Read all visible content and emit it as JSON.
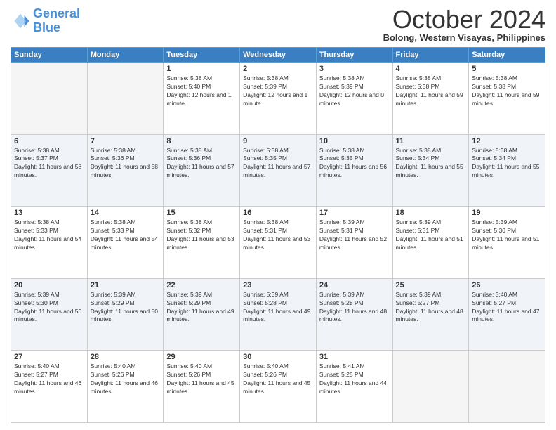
{
  "logo": {
    "line1": "General",
    "line2": "Blue"
  },
  "title": "October 2024",
  "location": "Bolong, Western Visayas, Philippines",
  "days_of_week": [
    "Sunday",
    "Monday",
    "Tuesday",
    "Wednesday",
    "Thursday",
    "Friday",
    "Saturday"
  ],
  "weeks": [
    [
      {
        "day": "",
        "info": ""
      },
      {
        "day": "",
        "info": ""
      },
      {
        "day": "1",
        "info": "Sunrise: 5:38 AM\nSunset: 5:40 PM\nDaylight: 12 hours and 1 minute."
      },
      {
        "day": "2",
        "info": "Sunrise: 5:38 AM\nSunset: 5:39 PM\nDaylight: 12 hours and 1 minute."
      },
      {
        "day": "3",
        "info": "Sunrise: 5:38 AM\nSunset: 5:39 PM\nDaylight: 12 hours and 0 minutes."
      },
      {
        "day": "4",
        "info": "Sunrise: 5:38 AM\nSunset: 5:38 PM\nDaylight: 11 hours and 59 minutes."
      },
      {
        "day": "5",
        "info": "Sunrise: 5:38 AM\nSunset: 5:38 PM\nDaylight: 11 hours and 59 minutes."
      }
    ],
    [
      {
        "day": "6",
        "info": "Sunrise: 5:38 AM\nSunset: 5:37 PM\nDaylight: 11 hours and 58 minutes."
      },
      {
        "day": "7",
        "info": "Sunrise: 5:38 AM\nSunset: 5:36 PM\nDaylight: 11 hours and 58 minutes."
      },
      {
        "day": "8",
        "info": "Sunrise: 5:38 AM\nSunset: 5:36 PM\nDaylight: 11 hours and 57 minutes."
      },
      {
        "day": "9",
        "info": "Sunrise: 5:38 AM\nSunset: 5:35 PM\nDaylight: 11 hours and 57 minutes."
      },
      {
        "day": "10",
        "info": "Sunrise: 5:38 AM\nSunset: 5:35 PM\nDaylight: 11 hours and 56 minutes."
      },
      {
        "day": "11",
        "info": "Sunrise: 5:38 AM\nSunset: 5:34 PM\nDaylight: 11 hours and 55 minutes."
      },
      {
        "day": "12",
        "info": "Sunrise: 5:38 AM\nSunset: 5:34 PM\nDaylight: 11 hours and 55 minutes."
      }
    ],
    [
      {
        "day": "13",
        "info": "Sunrise: 5:38 AM\nSunset: 5:33 PM\nDaylight: 11 hours and 54 minutes."
      },
      {
        "day": "14",
        "info": "Sunrise: 5:38 AM\nSunset: 5:33 PM\nDaylight: 11 hours and 54 minutes."
      },
      {
        "day": "15",
        "info": "Sunrise: 5:38 AM\nSunset: 5:32 PM\nDaylight: 11 hours and 53 minutes."
      },
      {
        "day": "16",
        "info": "Sunrise: 5:38 AM\nSunset: 5:31 PM\nDaylight: 11 hours and 53 minutes."
      },
      {
        "day": "17",
        "info": "Sunrise: 5:39 AM\nSunset: 5:31 PM\nDaylight: 11 hours and 52 minutes."
      },
      {
        "day": "18",
        "info": "Sunrise: 5:39 AM\nSunset: 5:31 PM\nDaylight: 11 hours and 51 minutes."
      },
      {
        "day": "19",
        "info": "Sunrise: 5:39 AM\nSunset: 5:30 PM\nDaylight: 11 hours and 51 minutes."
      }
    ],
    [
      {
        "day": "20",
        "info": "Sunrise: 5:39 AM\nSunset: 5:30 PM\nDaylight: 11 hours and 50 minutes."
      },
      {
        "day": "21",
        "info": "Sunrise: 5:39 AM\nSunset: 5:29 PM\nDaylight: 11 hours and 50 minutes."
      },
      {
        "day": "22",
        "info": "Sunrise: 5:39 AM\nSunset: 5:29 PM\nDaylight: 11 hours and 49 minutes."
      },
      {
        "day": "23",
        "info": "Sunrise: 5:39 AM\nSunset: 5:28 PM\nDaylight: 11 hours and 49 minutes."
      },
      {
        "day": "24",
        "info": "Sunrise: 5:39 AM\nSunset: 5:28 PM\nDaylight: 11 hours and 48 minutes."
      },
      {
        "day": "25",
        "info": "Sunrise: 5:39 AM\nSunset: 5:27 PM\nDaylight: 11 hours and 48 minutes."
      },
      {
        "day": "26",
        "info": "Sunrise: 5:40 AM\nSunset: 5:27 PM\nDaylight: 11 hours and 47 minutes."
      }
    ],
    [
      {
        "day": "27",
        "info": "Sunrise: 5:40 AM\nSunset: 5:27 PM\nDaylight: 11 hours and 46 minutes."
      },
      {
        "day": "28",
        "info": "Sunrise: 5:40 AM\nSunset: 5:26 PM\nDaylight: 11 hours and 46 minutes."
      },
      {
        "day": "29",
        "info": "Sunrise: 5:40 AM\nSunset: 5:26 PM\nDaylight: 11 hours and 45 minutes."
      },
      {
        "day": "30",
        "info": "Sunrise: 5:40 AM\nSunset: 5:26 PM\nDaylight: 11 hours and 45 minutes."
      },
      {
        "day": "31",
        "info": "Sunrise: 5:41 AM\nSunset: 5:25 PM\nDaylight: 11 hours and 44 minutes."
      },
      {
        "day": "",
        "info": ""
      },
      {
        "day": "",
        "info": ""
      }
    ]
  ]
}
